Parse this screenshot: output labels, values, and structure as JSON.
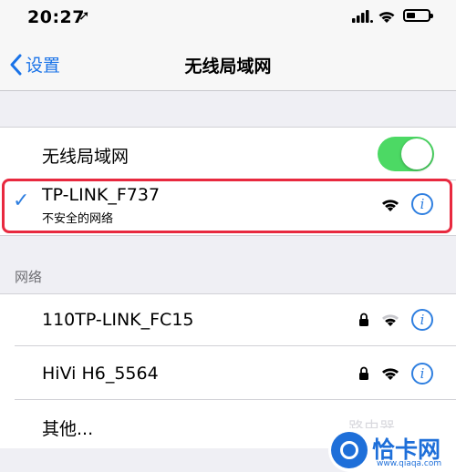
{
  "status_bar": {
    "time": "20:27",
    "location_glyph": "➚"
  },
  "nav": {
    "back_label": "设置",
    "title": "无线局域网"
  },
  "wifi_toggle": {
    "label": "无线局域网",
    "on": true
  },
  "connected": {
    "name": "TP-LINK_F737",
    "subtitle": "不安全的网络",
    "checkmark": "✓"
  },
  "networks_header": "网络",
  "networks": [
    {
      "name": "110TP-LINK_FC15",
      "locked": true
    },
    {
      "name": "HiVi H6_5564",
      "locked": true
    }
  ],
  "other_label": "其他...",
  "info_glyph": "i",
  "watermark": {
    "ghost": "路由器",
    "name": "恰卡网",
    "url": "www.qiaqa.com"
  },
  "colors": {
    "accent": "#2f7fe0",
    "toggle_on": "#4cd964",
    "highlight": "#e8293f"
  }
}
